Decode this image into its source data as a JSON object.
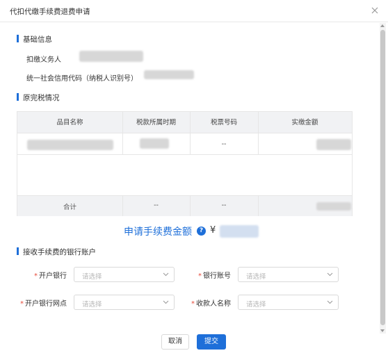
{
  "dialog": {
    "title": "代扣代缴手续费退费申请",
    "close_icon": "close-icon"
  },
  "basic_info": {
    "section_title": "基础信息",
    "withholding_agent_label": "扣缴义务人",
    "credit_code_label": "统一社会信用代码（纳税人识别号）"
  },
  "tax_status": {
    "section_title": "原完税情况",
    "columns": [
      "品目名称",
      "税款所属时期",
      "税票号码",
      "实缴金额"
    ],
    "row1": {
      "ticket_no": "--"
    },
    "total_row": {
      "label": "合计",
      "period": "--",
      "ticket_no": "--"
    }
  },
  "fee": {
    "label": "申请手续费金额",
    "help_icon": "help-icon",
    "currency": "¥"
  },
  "bank_account": {
    "section_title": "接收手续费的银行账户",
    "required_mark": "*",
    "fields": {
      "bank": {
        "label": "开户银行",
        "placeholder": "请选择"
      },
      "account": {
        "label": "银行账号",
        "placeholder": "请选择"
      },
      "branch": {
        "label": "开户银行网点",
        "placeholder": "请选择"
      },
      "payee": {
        "label": "收款人名称",
        "placeholder": "请选择"
      }
    }
  },
  "actions": {
    "cancel_label": "取消",
    "submit_label": "提交"
  },
  "colors": {
    "accent": "#1e6fd9",
    "required": "#e74c3c",
    "table_header_bg": "#f1f2f4"
  }
}
